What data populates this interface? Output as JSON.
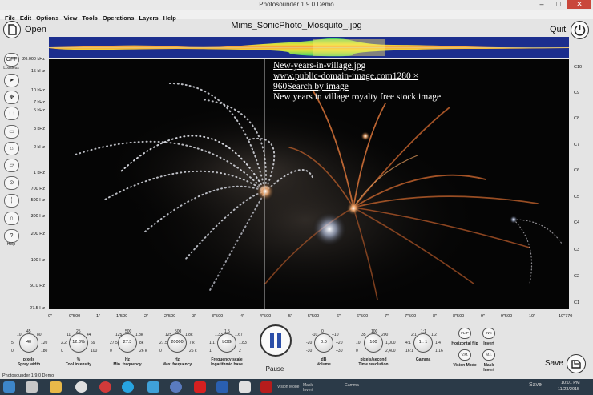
{
  "window": {
    "title": "Photosounder 1.9.0 Demo"
  },
  "menu": [
    "File",
    "Edit",
    "Options",
    "View",
    "Tools",
    "Operations",
    "Layers",
    "Help"
  ],
  "header": {
    "open_label": "Open",
    "filename": "Mims_SonicPhoto_Mosquito_.jpg",
    "quit_label": "Quit"
  },
  "tools": {
    "off": "OFF",
    "lossless": "Lossless",
    "help": "Help"
  },
  "freq_labels": [
    "20.000 kHz",
    "15 kHz",
    "10 kHz",
    "7 kHz",
    "5 kHz",
    "3 kHz",
    "2 kHz",
    "1 kHz",
    "700 Hz",
    "500 Hz",
    "300 Hz",
    "200 Hz",
    "100 Hz",
    "50.0 Hz",
    "27.5 Hz"
  ],
  "note_labels": [
    "C10",
    "C9",
    "C8",
    "C7",
    "C6",
    "C5",
    "C4",
    "C3",
    "C2",
    "C1"
  ],
  "time_labels": [
    "0\"",
    "0\"500",
    "1\"",
    "1\"500",
    "2\"",
    "2\"500",
    "3\"",
    "3\"500",
    "4\"",
    "4\"500",
    "5\"",
    "5\"500",
    "6\"",
    "6\"500",
    "7\"",
    "7\"500",
    "8\"",
    "8\"500",
    "9\"",
    "9\"500",
    "10\"",
    "10\"770"
  ],
  "overlay_text": [
    "New-years-in-village.jpg",
    "www.public-domain-image.com1280 ×",
    "960Search by image",
    "New years in village royalty free stock image"
  ],
  "knobs": [
    {
      "value": "40",
      "label": "pixels\nSpray width",
      "scale": [
        "10",
        "45",
        "80",
        "5",
        "120",
        "0",
        "180"
      ]
    },
    {
      "value": "12.3%",
      "label": "%\nTool intensity",
      "scale": [
        "11",
        "25",
        "44",
        "2.2",
        "69",
        "0",
        "100"
      ]
    },
    {
      "value": "27.3",
      "label": "Hz\nMin. frequency",
      "scale": [
        "125",
        "500",
        "1.8k",
        "27.5",
        "8k",
        "0",
        "26 k"
      ]
    },
    {
      "value": "20000",
      "label": "Hz\nMax. frequency",
      "scale": [
        "125",
        "500",
        "1.8k",
        "27.5",
        "7 k",
        "0",
        "26 k"
      ]
    },
    {
      "value": "LOG",
      "label": "Frequency scale\nlogarithmic base",
      "scale": [
        "1.33",
        "1.5",
        "1.67",
        "1.17",
        "1.83",
        "1",
        "2"
      ]
    },
    {
      "value": "0.0",
      "label": "dB\nVolume",
      "scale": [
        "-10",
        "0",
        "+10",
        "-20",
        "+20",
        "-30",
        "+30"
      ]
    },
    {
      "value": "100",
      "label": "pixels/second\nTime resolution",
      "scale": [
        "35",
        "100",
        "200",
        "10",
        "1,000",
        "0",
        "2,400"
      ]
    },
    {
      "value": "1 : 1",
      "label": "Gamma",
      "scale": [
        "2:1",
        "1:1",
        "1:2",
        "4:1",
        "1:4",
        "16:1",
        "1:16"
      ]
    }
  ],
  "transport": {
    "pause_label": "Pause"
  },
  "modes": {
    "flip": "FLIP",
    "flip_label": "Horizontal flip",
    "inv": "INV.",
    "inv_label": "Invert",
    "vm": "V.M.",
    "vm_label": "Vision Mode",
    "mi": "M.I.",
    "mi_label": "Mask\nInvert"
  },
  "footer": {
    "status": "Photosounder 1.9.0 Demo",
    "save_label": "Save"
  },
  "taskbar": {
    "time": "10:01 PM",
    "date": "11/23/2015",
    "items": [
      "Vision Mode",
      "Mask\nInvert",
      "Gamma"
    ],
    "save_label": "Save"
  },
  "colors": {
    "accent_blue": "#1c2e8e",
    "spectrogram_bg": "#050505",
    "taskbar": "#2b3a48"
  }
}
